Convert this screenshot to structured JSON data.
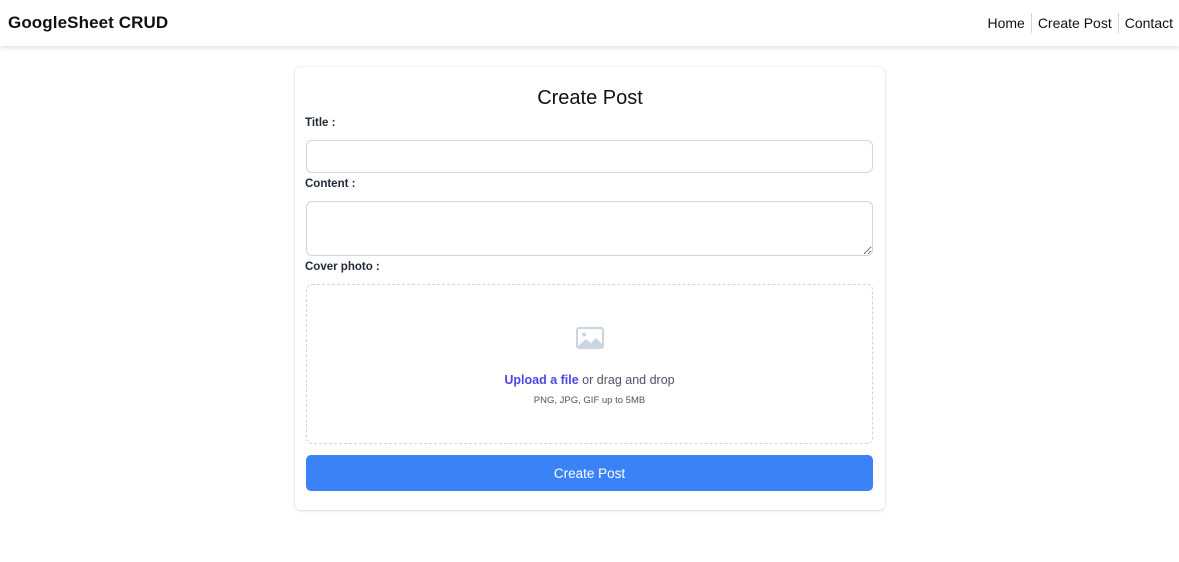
{
  "navbar": {
    "brand": "GoogleSheet CRUD",
    "links": [
      "Home",
      "Create Post",
      "Contact"
    ]
  },
  "form": {
    "heading": "Create Post",
    "title_label": "Title :",
    "title_value": "",
    "content_label": "Content :",
    "content_value": "",
    "cover_label": "Cover photo :",
    "upload": {
      "icon": "photo-icon",
      "link_text": "Upload a file",
      "rest_text": " or drag and drop",
      "hint": "PNG, JPG, GIF up to 5MB"
    },
    "submit_label": "Create Post"
  },
  "colors": {
    "primary_button": "#3b82f6",
    "upload_link": "#4f46e5",
    "input_border": "#d1d5db"
  }
}
